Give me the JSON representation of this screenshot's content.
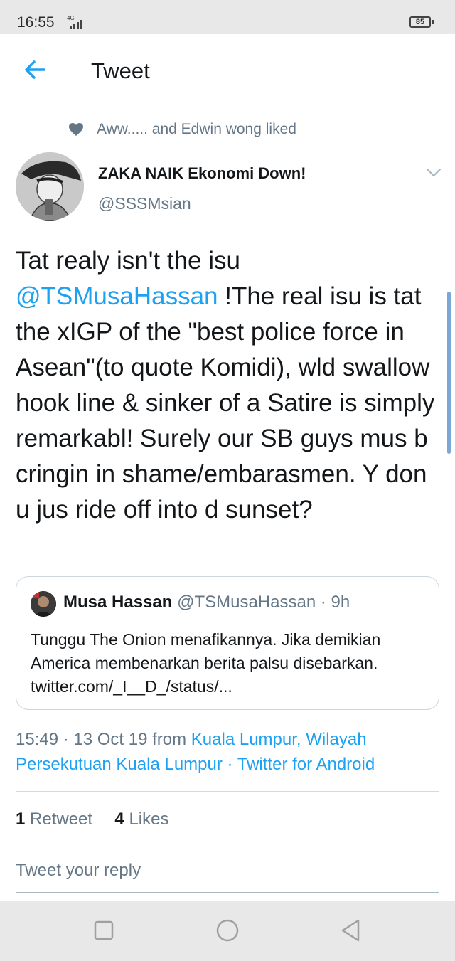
{
  "status_bar": {
    "time": "16:55",
    "network": "4G",
    "battery": "85"
  },
  "header": {
    "title": "Tweet",
    "back_icon": "arrow-left-icon"
  },
  "social_context": {
    "text": "Aww..... and Edwin wong liked",
    "icon": "heart-icon"
  },
  "author": {
    "name": "ZAKA NAIK Ekonomi Down!",
    "handle": "@SSSMsian"
  },
  "tweet": {
    "text_before": "Tat realy isn't the isu ",
    "mention": "@TSMusaHassan",
    "text_after": " !The real isu is tat the xIGP of the \"best police force in Asean\"(to quote Komidi), wld swallow hook line & sinker of a Satire is simply remarkabl! Surely our SB guys mus b cringin in shame/embarasmen. Y don u jus ride off into d sunset?"
  },
  "quoted_tweet": {
    "name": "Musa Hassan",
    "meta": " @TSMusaHassan · 9h",
    "text": "Tunggu The Onion menafikannya. Jika demikian America membenarkan berita palsu disebarkan. twitter.com/_I__D_/status/..."
  },
  "meta": {
    "time_date": "15:49 · 13 Oct 19 from ",
    "location": "Kuala Lumpur, Wilayah Persekutuan Kuala Lumpur",
    "separator": " · ",
    "source": "Twitter for Android"
  },
  "stats": {
    "retweet_count": "1",
    "retweet_label": " Retweet",
    "like_count": "4",
    "like_label": " Likes"
  },
  "reply": {
    "placeholder": "Tweet your reply"
  },
  "colors": {
    "accent": "#1da1f2",
    "secondary_text": "#657786",
    "primary_text": "#14171a",
    "border": "#ccd6dd"
  },
  "navbar": {
    "icons": [
      "square-recents-icon",
      "circle-home-icon",
      "triangle-back-icon"
    ]
  }
}
